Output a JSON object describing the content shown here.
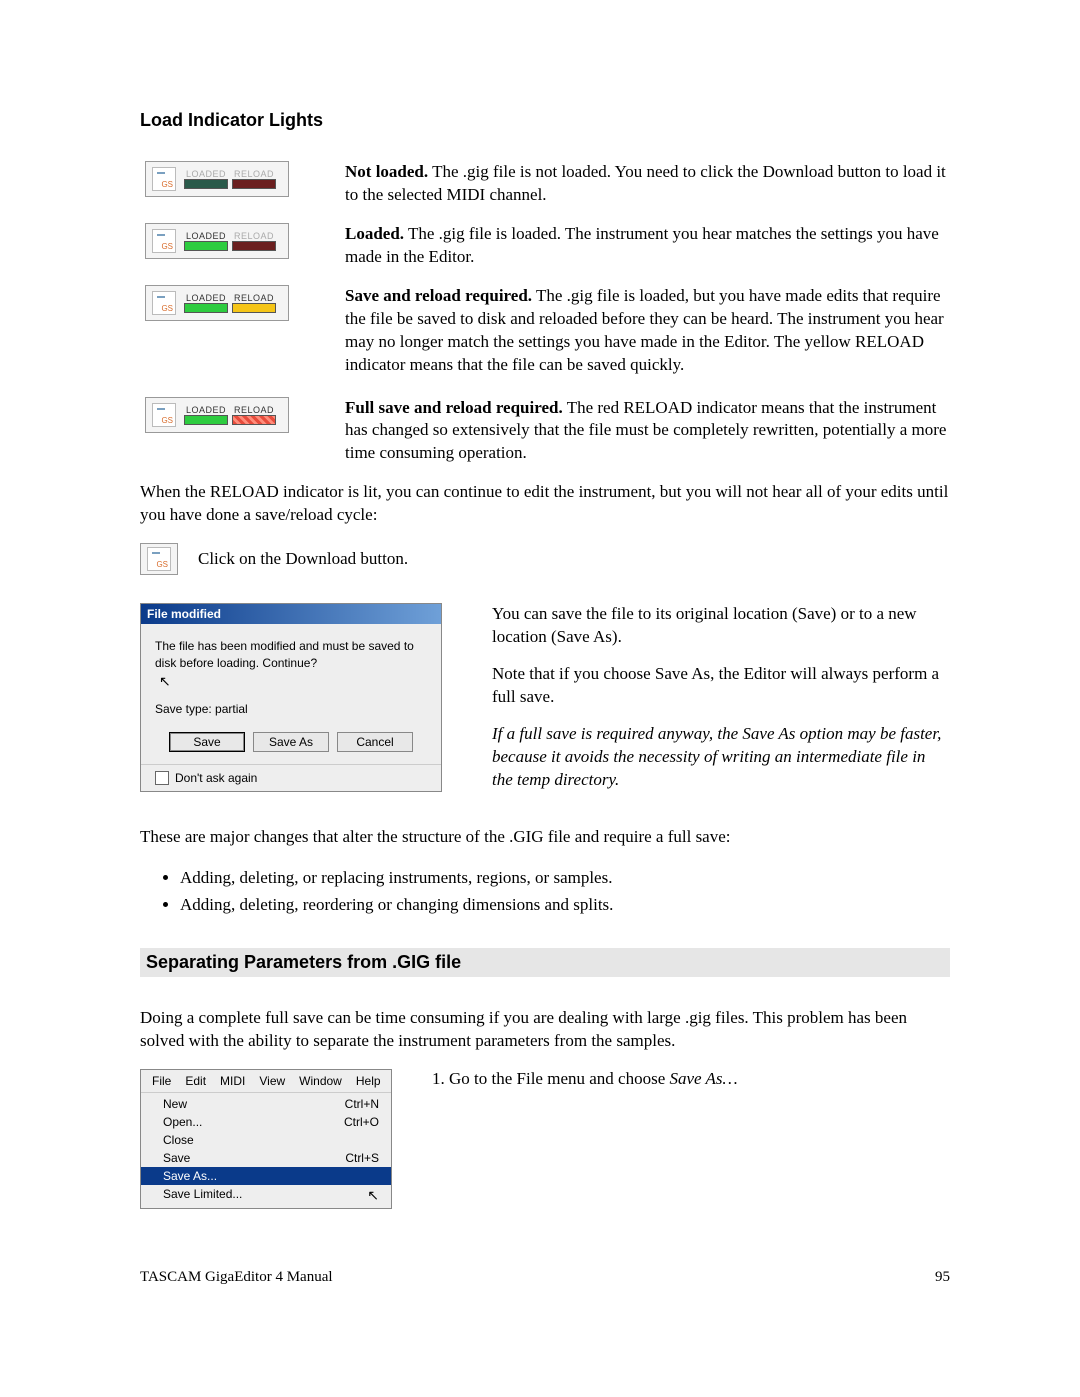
{
  "headings": {
    "h1": "Load Indicator Lights",
    "h2": "Separating Parameters from .GIG file"
  },
  "indicator": {
    "loaded_label": "LOADED",
    "reload_label": "RELOAD",
    "gs": "GS"
  },
  "states": {
    "not_loaded": {
      "bold": "Not loaded.",
      "text": "The .gig file is not loaded. You need to click the Download button to load it to the selected MIDI channel."
    },
    "loaded": {
      "bold": "Loaded.",
      "text": "The .gig file is loaded. The instrument you hear matches the settings you have made in the Editor."
    },
    "save_reload": {
      "bold": "Save and reload required.",
      "text": "The .gig file is loaded, but you have made edits that require the file be saved to disk and reloaded before they can be heard. The instrument you hear may no longer match the settings you have made in the Editor. The yellow RELOAD indicator means that the file can be saved quickly."
    },
    "full_save": {
      "bold": "Full save and reload required.",
      "text": "The red RELOAD indicator means that the instrument has changed so extensively that the file must be completely rewritten, potentially a more time consuming operation."
    }
  },
  "para1": "When the RELOAD indicator is lit, you can continue to edit the instrument, but you will not hear all of your edits until you have done a save/reload cycle:",
  "download_hint": "Click on the Download button.",
  "dialog": {
    "title": "File modified",
    "msg": "The file has been modified and must be saved to disk before loading.  Continue?",
    "save_type": "Save type: partial",
    "btn_save": "Save",
    "btn_saveas": "Save As",
    "btn_cancel": "Cancel",
    "dont_ask": "Don't ask again"
  },
  "sidetext": {
    "p1": "You can save the file to its original location (Save) or to a new location (Save As).",
    "p2": "Note that if you choose Save As, the Editor will always perform a full save.",
    "p3": "If a full save is required anyway, the Save As option may be faster, because it avoids the necessity of writing an intermediate file in the temp directory."
  },
  "para2": "These are major changes that alter the structure of the .GIG file and require a full save:",
  "bullets": [
    "Adding, deleting, or replacing instruments, regions, or samples.",
    "Adding, deleting, reordering or changing dimensions and splits."
  ],
  "para3": "Doing a complete full save can be time consuming if you are dealing with large .gig files. This problem has been solved with the ability to separate the instrument parameters from the samples.",
  "menubar": [
    "File",
    "Edit",
    "MIDI",
    "View",
    "Window",
    "Help"
  ],
  "menuitems": [
    {
      "label": "New",
      "accel": "Ctrl+N"
    },
    {
      "label": "Open...",
      "accel": "Ctrl+O"
    },
    {
      "label": "Close",
      "accel": ""
    },
    {
      "label": "Save",
      "accel": "Ctrl+S"
    },
    {
      "label": "Save As...",
      "accel": ""
    },
    {
      "label": "Save Limited...",
      "accel": ""
    }
  ],
  "step1_prefix": "1. Go to the File menu and choose ",
  "step1_italic": "Save As…",
  "footer_left": "TASCAM GigaEditor 4 Manual",
  "footer_right": "95"
}
